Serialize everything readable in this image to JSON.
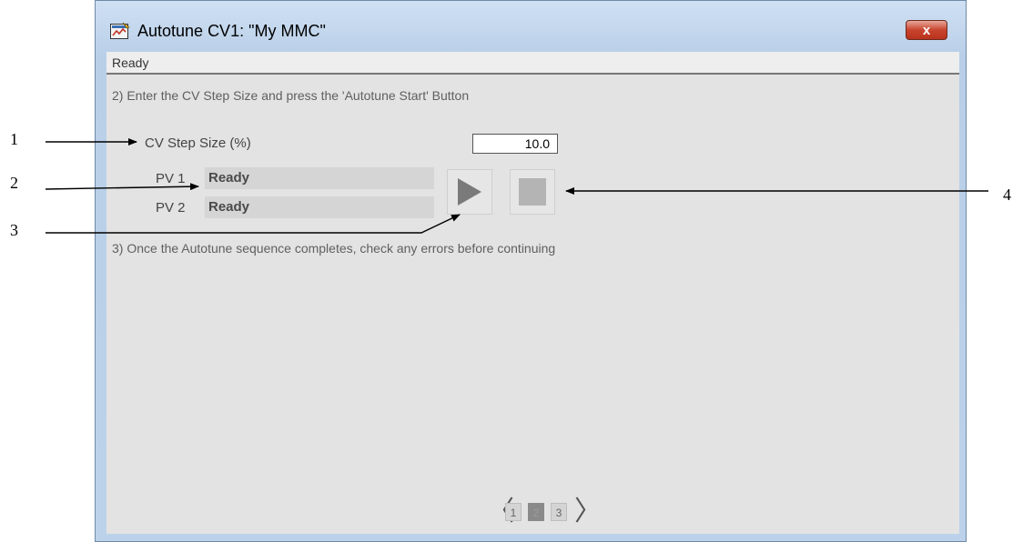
{
  "window": {
    "title": "Autotune CV1:  \"My MMC\"",
    "close_label": "x",
    "status": "Ready"
  },
  "step2": {
    "instruction": "2) Enter the CV Step Size and press the 'Autotune Start' Button"
  },
  "cv_step": {
    "label": "CV Step Size (%)",
    "value": "10.0"
  },
  "pv_rows": [
    {
      "label": "PV 1",
      "value": "Ready"
    },
    {
      "label": "PV 2",
      "value": "Ready"
    }
  ],
  "step3": {
    "instruction": "3) Once the Autotune sequence completes, check any errors before continuing"
  },
  "pager": {
    "pages": [
      "1",
      "2",
      "3"
    ],
    "current": "2",
    "prev_glyph": "〈",
    "next_glyph": "〉"
  },
  "callouts": [
    "1",
    "2",
    "3",
    "4"
  ],
  "icons": {
    "start": "play-icon",
    "stop": "stop-icon",
    "app": "autotune-app-icon"
  },
  "colors": {
    "close_button": "#c9442e",
    "title_bar": "#b9cfe8",
    "client_bg": "#e3e3e3"
  }
}
